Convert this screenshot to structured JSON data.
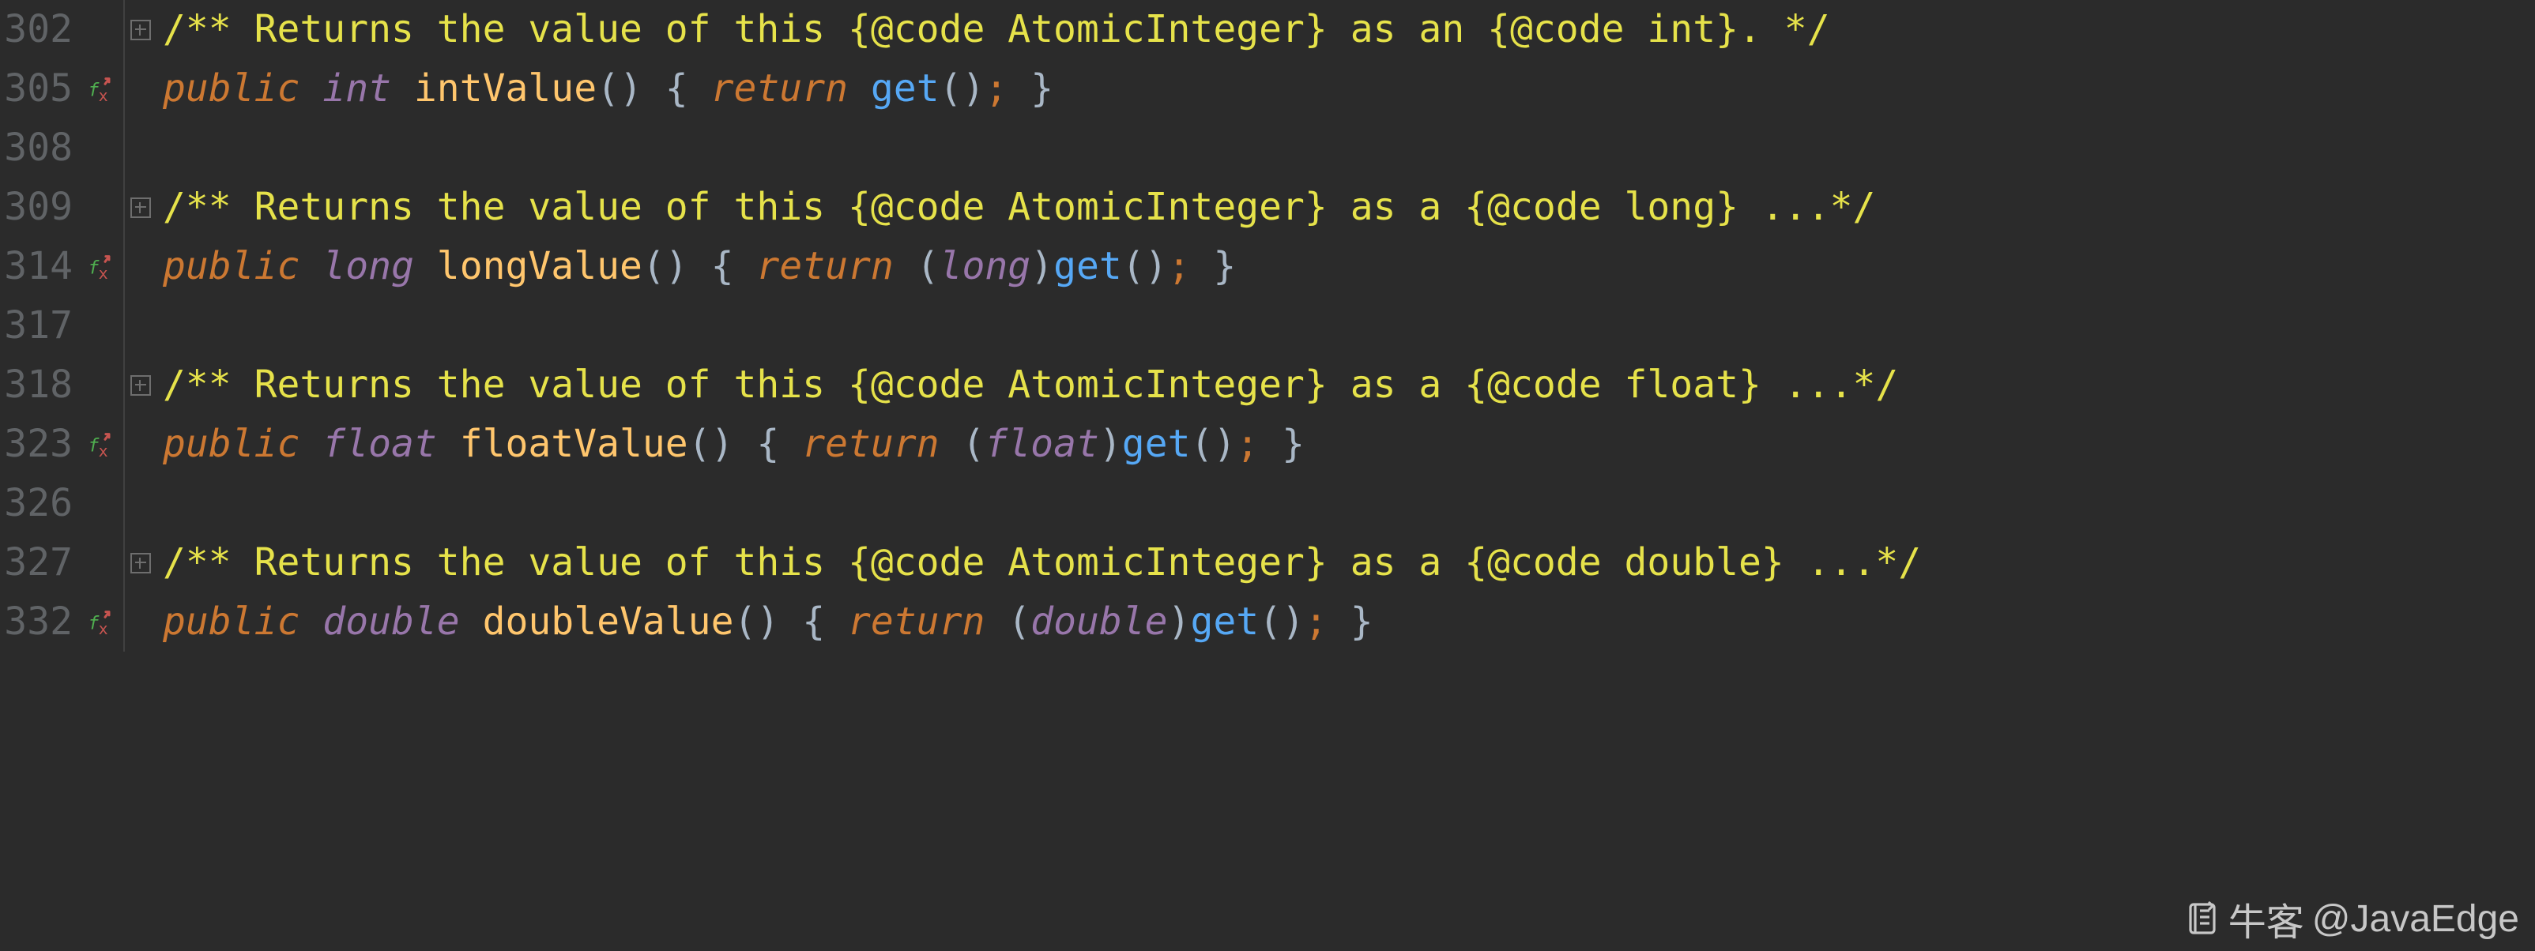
{
  "colors": {
    "bg": "#2b2b2b",
    "gutter": "#606366",
    "comment": "#e6e24a",
    "keyword": "#cc7832",
    "type": "#9876aa",
    "method": "#56a8f5",
    "decl": "#ffc66d"
  },
  "watermark": {
    "site": "牛客",
    "handle": "@JavaEdge"
  },
  "lines": [
    {
      "num": "302",
      "fx": false,
      "fold": true,
      "tokens": [
        {
          "cls": "c-comment",
          "t": "/** Returns the value of this {@code AtomicInteger} as an {@code int}. */"
        }
      ]
    },
    {
      "num": "305",
      "fx": true,
      "fold": false,
      "tokens": [
        {
          "cls": "c-kw",
          "t": "public"
        },
        {
          "cls": "",
          "t": " "
        },
        {
          "cls": "c-type",
          "t": "int"
        },
        {
          "cls": "",
          "t": " "
        },
        {
          "cls": "c-decl",
          "t": "intValue"
        },
        {
          "cls": "c-paren",
          "t": "() "
        },
        {
          "cls": "c-brace",
          "t": "{ "
        },
        {
          "cls": "c-kw",
          "t": "return"
        },
        {
          "cls": "",
          "t": " "
        },
        {
          "cls": "c-method",
          "t": "get"
        },
        {
          "cls": "c-paren",
          "t": "()"
        },
        {
          "cls": "c-semi",
          "t": ";"
        },
        {
          "cls": "c-brace",
          "t": " }"
        }
      ]
    },
    {
      "num": "308",
      "fx": false,
      "fold": false,
      "tokens": []
    },
    {
      "num": "309",
      "fx": false,
      "fold": true,
      "tokens": [
        {
          "cls": "c-comment",
          "t": "/** Returns the value of this {@code AtomicInteger} as a {@code long} ...*/"
        }
      ]
    },
    {
      "num": "314",
      "fx": true,
      "fold": false,
      "tokens": [
        {
          "cls": "c-kw",
          "t": "public"
        },
        {
          "cls": "",
          "t": " "
        },
        {
          "cls": "c-type",
          "t": "long"
        },
        {
          "cls": "",
          "t": " "
        },
        {
          "cls": "c-decl",
          "t": "longValue"
        },
        {
          "cls": "c-paren",
          "t": "() "
        },
        {
          "cls": "c-brace",
          "t": "{ "
        },
        {
          "cls": "c-kw",
          "t": "return"
        },
        {
          "cls": "",
          "t": " ("
        },
        {
          "cls": "c-cast",
          "t": "long"
        },
        {
          "cls": "",
          "t": ")"
        },
        {
          "cls": "c-method",
          "t": "get"
        },
        {
          "cls": "c-paren",
          "t": "()"
        },
        {
          "cls": "c-semi",
          "t": ";"
        },
        {
          "cls": "c-brace",
          "t": " }"
        }
      ]
    },
    {
      "num": "317",
      "fx": false,
      "fold": false,
      "tokens": []
    },
    {
      "num": "318",
      "fx": false,
      "fold": true,
      "tokens": [
        {
          "cls": "c-comment",
          "t": "/** Returns the value of this {@code AtomicInteger} as a {@code float} ...*/"
        }
      ]
    },
    {
      "num": "323",
      "fx": true,
      "fold": false,
      "tokens": [
        {
          "cls": "c-kw",
          "t": "public"
        },
        {
          "cls": "",
          "t": " "
        },
        {
          "cls": "c-type",
          "t": "float"
        },
        {
          "cls": "",
          "t": " "
        },
        {
          "cls": "c-decl",
          "t": "floatValue"
        },
        {
          "cls": "c-paren",
          "t": "() "
        },
        {
          "cls": "c-brace",
          "t": "{ "
        },
        {
          "cls": "c-kw",
          "t": "return"
        },
        {
          "cls": "",
          "t": " ("
        },
        {
          "cls": "c-cast",
          "t": "float"
        },
        {
          "cls": "",
          "t": ")"
        },
        {
          "cls": "c-method",
          "t": "get"
        },
        {
          "cls": "c-paren",
          "t": "()"
        },
        {
          "cls": "c-semi",
          "t": ";"
        },
        {
          "cls": "c-brace",
          "t": " }"
        }
      ]
    },
    {
      "num": "326",
      "fx": false,
      "fold": false,
      "tokens": []
    },
    {
      "num": "327",
      "fx": false,
      "fold": true,
      "tokens": [
        {
          "cls": "c-comment",
          "t": "/** Returns the value of this {@code AtomicInteger} as a {@code double} ...*/"
        }
      ]
    },
    {
      "num": "332",
      "fx": true,
      "fold": false,
      "tokens": [
        {
          "cls": "c-kw",
          "t": "public"
        },
        {
          "cls": "",
          "t": " "
        },
        {
          "cls": "c-type",
          "t": "double"
        },
        {
          "cls": "",
          "t": " "
        },
        {
          "cls": "c-decl",
          "t": "doubleValue"
        },
        {
          "cls": "c-paren",
          "t": "() "
        },
        {
          "cls": "c-brace",
          "t": "{ "
        },
        {
          "cls": "c-kw",
          "t": "return"
        },
        {
          "cls": "",
          "t": " ("
        },
        {
          "cls": "c-cast",
          "t": "double"
        },
        {
          "cls": "",
          "t": ")"
        },
        {
          "cls": "c-method",
          "t": "get"
        },
        {
          "cls": "c-paren",
          "t": "()"
        },
        {
          "cls": "c-semi",
          "t": ";"
        },
        {
          "cls": "c-brace",
          "t": " }"
        }
      ]
    }
  ]
}
